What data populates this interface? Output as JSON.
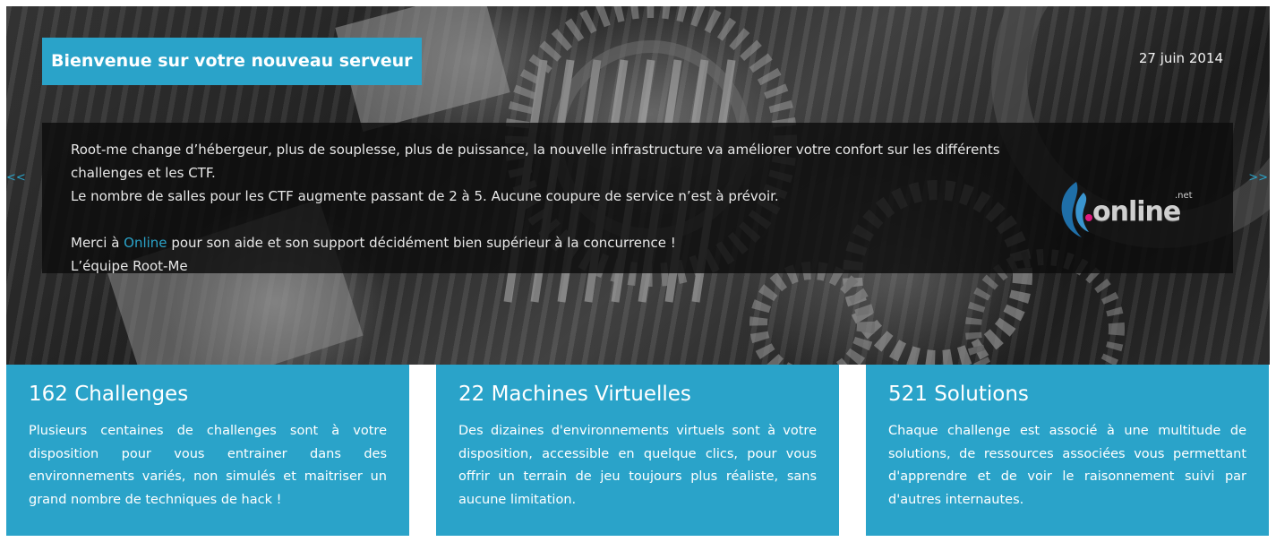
{
  "slider": {
    "title": "Bienvenue sur votre nouveau serveur",
    "date": "27 juin 2014",
    "line1": "Root-me change d’hébergeur, plus de souplesse, plus de puissance, la nouvelle infrastructure va améliorer votre confort sur les différents challenges et les CTF.",
    "line2": "Le nombre de salles pour les CTF augmente passant de 2 à 5. Aucune coupure de service n’est à prévoir.",
    "thanks_prefix": "Merci à ",
    "thanks_link": "Online",
    "thanks_suffix": " pour son aide et son support décidément bien supérieur à la concurrence !",
    "signature": "L’équipe Root-Me",
    "prev_label": "<<",
    "next_label": ">>",
    "logo": {
      "word": "online",
      "suffix": ".net",
      "icon": "online-logo-icon"
    }
  },
  "cards": [
    {
      "title": "162 Challenges",
      "text": "Plusieurs centaines de challenges sont à votre disposition pour vous entrainer dans des environnements variés, non simulés et maitriser un grand nombre de techniques de hack !"
    },
    {
      "title": "22 Machines Virtuelles",
      "text": "Des dizaines d'environnements virtuels sont à votre disposition, accessible en quelque clics, pour vous offrir un terrain de jeu toujours plus réaliste, sans aucune limitation."
    },
    {
      "title": "521 Solutions",
      "text": "Chaque challenge est associé à une multitude de solutions, de ressources associées vous permettant d'apprendre et de voir le raisonnement suivi par d'autres internautes."
    }
  ],
  "colors": {
    "accent": "#2aa3c9",
    "overlay": "#0c0c0c",
    "text_light": "#e8e8e8"
  }
}
